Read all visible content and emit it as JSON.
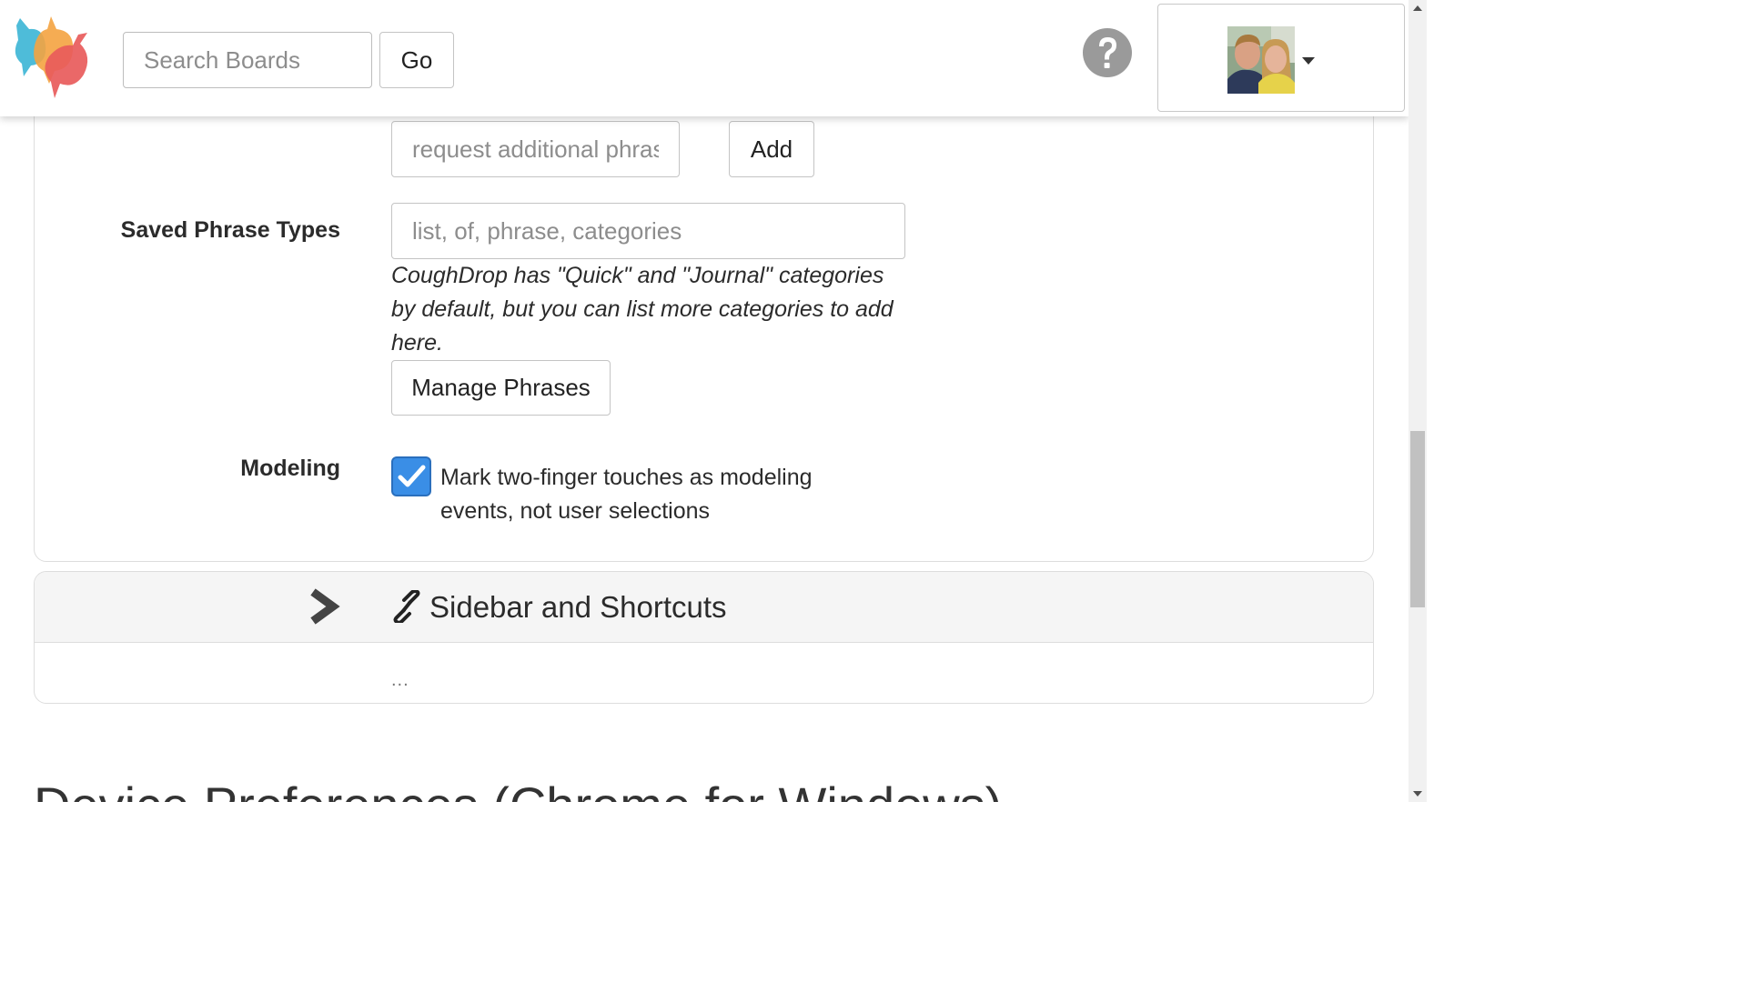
{
  "header": {
    "search": {
      "placeholder": "Search Boards"
    },
    "go_label": "Go"
  },
  "settings": {
    "phrase_request": {
      "placeholder": "request additional phras",
      "add_label": "Add"
    },
    "saved_phrase_types": {
      "label": "Saved Phrase Types",
      "placeholder": "list, of, phrase, categories",
      "help": "CoughDrop has \"Quick\" and \"Journal\" categories by default, but you can list more categories to add here.",
      "manage_label": "Manage Phrases"
    },
    "modeling": {
      "label": "Modeling",
      "checked": true,
      "checkbox_label": "Mark two-finger touches as modeling events, not user selections"
    }
  },
  "sidebar_section": {
    "title": "Sidebar and Shortcuts",
    "placeholder": "..."
  },
  "next_heading": "Device Preferences (Chrome for Windows)",
  "colors": {
    "checkbox": "#3a8ee6",
    "logo_blue": "#3fb6d6",
    "logo_orange": "#f4a340",
    "logo_red": "#e85b5b",
    "icon_gray": "#9a9a9a"
  }
}
